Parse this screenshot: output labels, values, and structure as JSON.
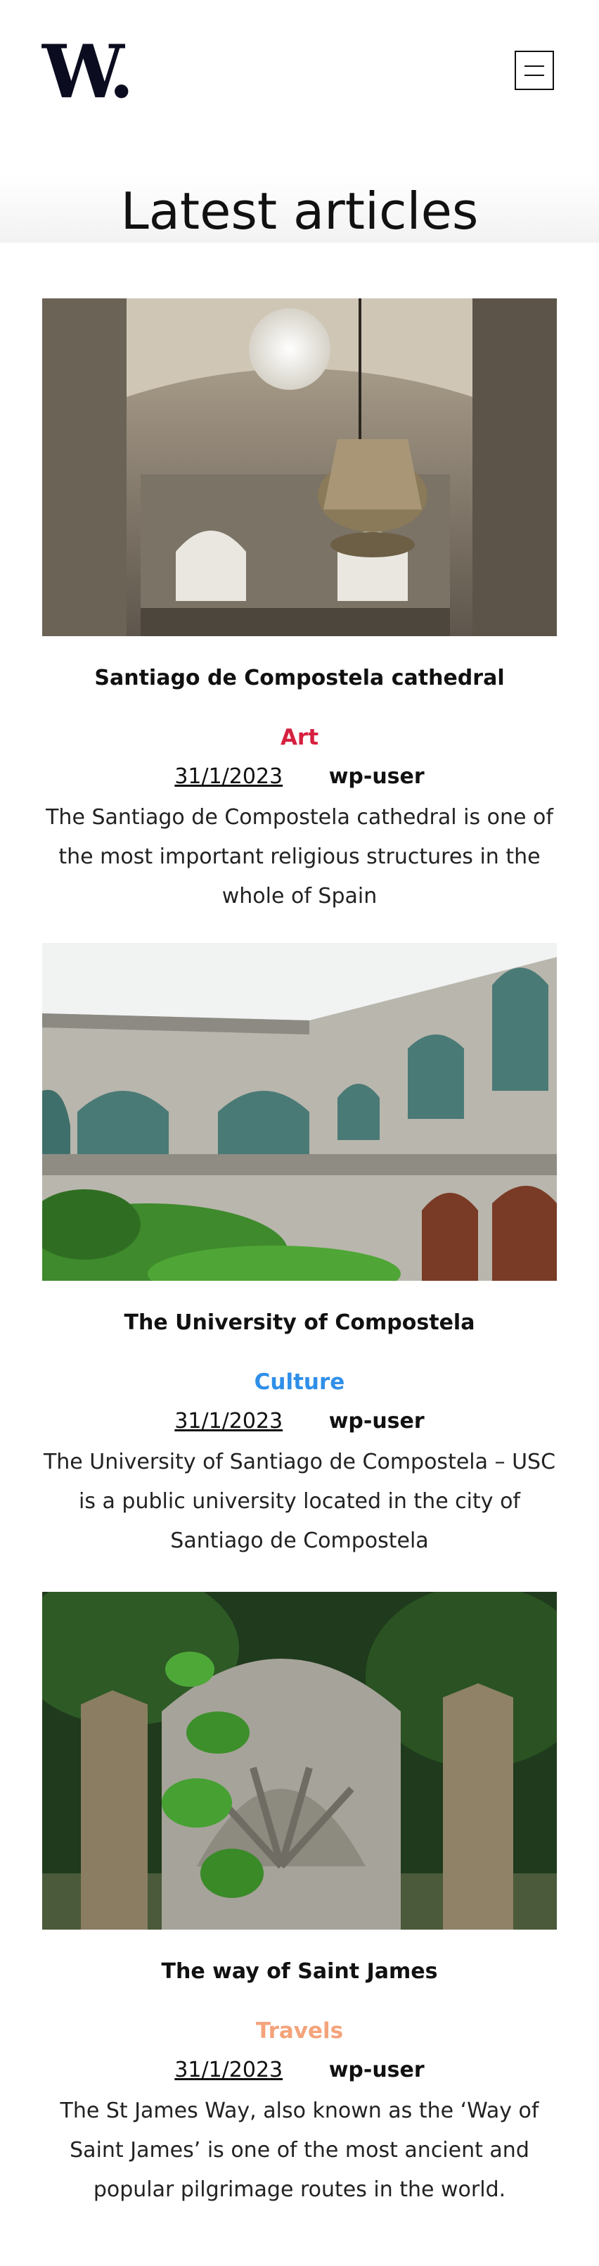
{
  "header": {
    "logo_text": "W.",
    "menu_icon": "hamburger-menu-icon"
  },
  "page": {
    "title": "Latest articles"
  },
  "colors": {
    "art": "#d6203f",
    "culture": "#2f8fe8",
    "travels": "#f4a37b"
  },
  "articles": [
    {
      "title": "Santiago de Compostela cathedral",
      "category": "Art",
      "date": "31/1/2023",
      "author": "wp-user",
      "excerpt": "The Santiago de Compostela cathedral is one of the most important religious structures in the whole of Spain",
      "image": "cathedral-interior-censer"
    },
    {
      "title": "The University of Compostela",
      "category": "Culture",
      "date": "31/1/2023",
      "author": "wp-user",
      "excerpt": "The University of Santiago de Compostela – USC is a public university located in the city of Santiago de Compostela",
      "image": "university-cloister-arcade"
    },
    {
      "title": "The way of Saint James",
      "category": "Travels",
      "date": "31/1/2023",
      "author": "wp-user",
      "excerpt": "The St James Way, also known as the ‘Way of Saint James’ is one of the most ancient and popular pilgrimage routes in the world.",
      "image": "stone-scallop-shell-marker"
    }
  ]
}
